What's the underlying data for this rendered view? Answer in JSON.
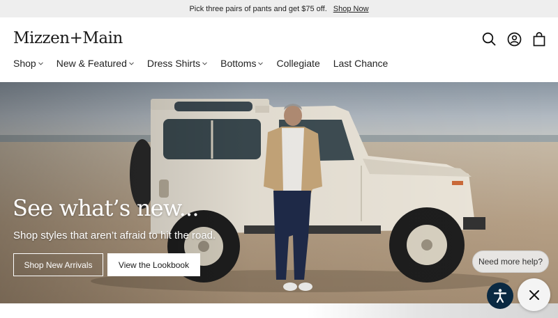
{
  "promo": {
    "text": "Pick three pairs of pants and get $75 off.",
    "link": "Shop Now"
  },
  "header": {
    "logo": "Mizzen+Main",
    "icons": [
      "search-icon",
      "account-icon",
      "bag-icon"
    ],
    "nav": [
      {
        "label": "Shop",
        "dropdown": true
      },
      {
        "label": "New & Featured",
        "dropdown": true
      },
      {
        "label": "Dress Shirts",
        "dropdown": true
      },
      {
        "label": "Bottoms",
        "dropdown": true
      },
      {
        "label": "Collegiate",
        "dropdown": false
      },
      {
        "label": "Last Chance",
        "dropdown": false
      }
    ]
  },
  "hero": {
    "title": "See what’s new...",
    "subtitle": "Shop styles that aren’t afraid to hit the road.",
    "primary_button": "Shop New Arrivals",
    "secondary_button": "View the Lookbook"
  },
  "help": {
    "bubble": "Need more help?"
  },
  "colors": {
    "promo_bg": "#eeeeee",
    "accessibility_bg": "#0a2942",
    "text": "#1a1a1a"
  }
}
